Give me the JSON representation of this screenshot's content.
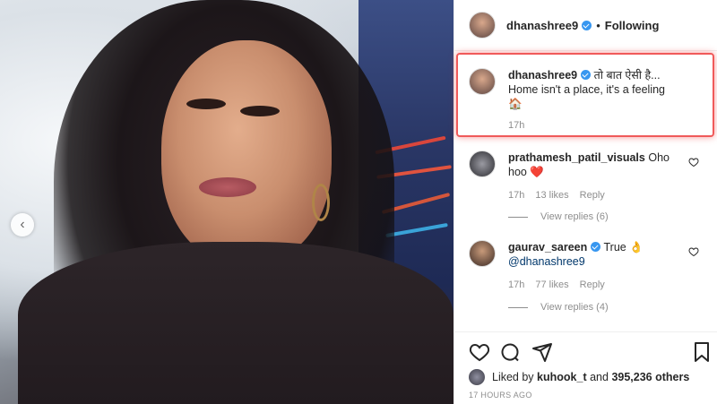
{
  "post": {
    "author": "dhanashree9",
    "follow_status": "Following",
    "separator": "•"
  },
  "caption": {
    "username": "dhanashree9",
    "line1": "तो बात ऐसी है...",
    "line2": "Home isn't a place, it's a feeling",
    "emoji": "🏠",
    "time": "17h"
  },
  "comments": [
    {
      "username": "prathamesh_patil_visuals",
      "text": "Oho hoo",
      "emoji": "❤️",
      "time": "17h",
      "likes": "13 likes",
      "reply": "Reply",
      "view_replies": "View replies (6)"
    },
    {
      "username": "gaurav_sareen",
      "text": "True",
      "emoji": "👌",
      "mention": "@dhanashree9",
      "time": "17h",
      "likes": "77 likes",
      "reply": "Reply",
      "view_replies": "View replies (4)"
    }
  ],
  "likes_line": {
    "prefix": "Liked by",
    "user": "kuhook_t",
    "middle": "and",
    "count": "395,236 others"
  },
  "timestamp": "17 HOURS AGO",
  "colors": {
    "verified": "#3897f0",
    "highlight": "#f05a5a",
    "secondary_text": "#8e8e8e"
  },
  "icons": [
    "chevron-left-icon",
    "verified-icon",
    "heart-icon",
    "comment-icon",
    "share-icon",
    "bookmark-icon"
  ]
}
